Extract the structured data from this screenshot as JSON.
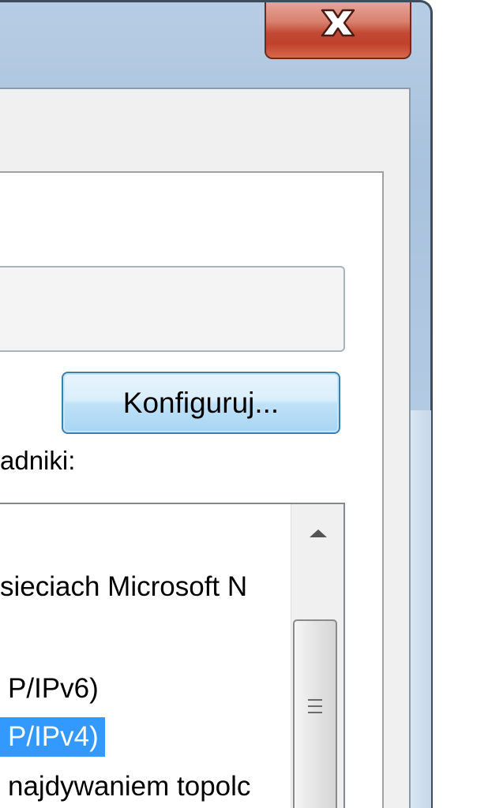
{
  "window": {
    "close_icon": "close-icon"
  },
  "configure_button": {
    "label": "Konfiguruj..."
  },
  "components": {
    "label": "adniki:",
    "items": [
      {
        "text": "sieciach Microsoft N",
        "selected": false
      },
      {
        "text": "P/IPv6)",
        "selected": false
      },
      {
        "text": "P/IPv4)",
        "selected": true
      },
      {
        "text": "najdywaniem topolc",
        "selected": false
      }
    ]
  },
  "scrollbar": {
    "up_icon": "chevron-up-icon",
    "grip_icon": "grip-icon"
  },
  "colors": {
    "selection": "#3399ff",
    "close_button": "#c24a34",
    "button_border": "#3c7fb1"
  }
}
